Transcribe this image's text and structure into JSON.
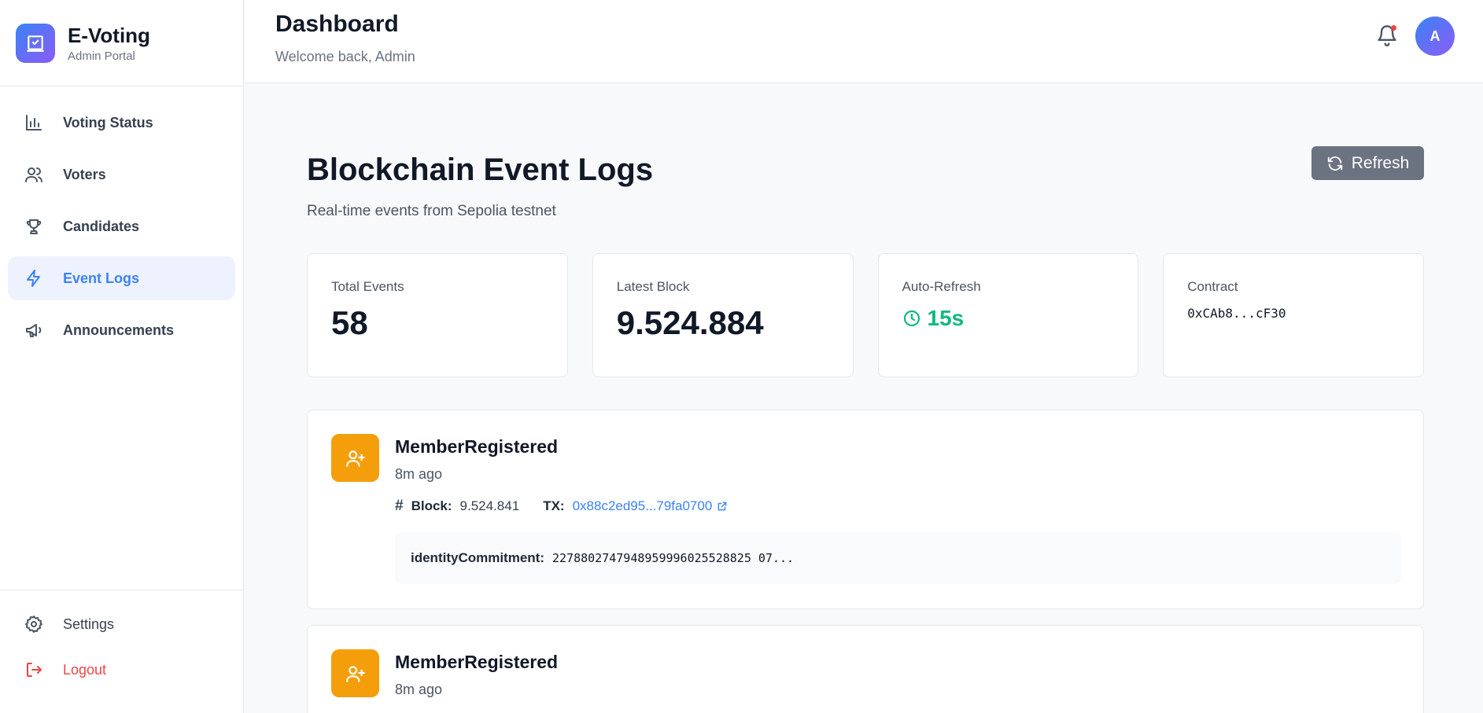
{
  "brand": {
    "name": "E-Voting",
    "subtitle": "Admin Portal"
  },
  "sidebar": {
    "items": [
      {
        "label": "Voting Status",
        "icon": "bar-chart-icon",
        "active": false
      },
      {
        "label": "Voters",
        "icon": "users-icon",
        "active": false
      },
      {
        "label": "Candidates",
        "icon": "trophy-icon",
        "active": false
      },
      {
        "label": "Event Logs",
        "icon": "lightning-icon",
        "active": true
      },
      {
        "label": "Announcements",
        "icon": "megaphone-icon",
        "active": false
      }
    ],
    "bottom": {
      "settings_label": "Settings",
      "logout_label": "Logout"
    }
  },
  "header": {
    "title": "Dashboard",
    "welcome": "Welcome back, Admin",
    "avatar_initial": "A",
    "has_notification": true
  },
  "page": {
    "title": "Blockchain Event Logs",
    "subtitle": "Real-time events from Sepolia testnet",
    "refresh_label": "Refresh"
  },
  "stats": {
    "total_events": {
      "label": "Total Events",
      "value": "58"
    },
    "latest_block": {
      "label": "Latest Block",
      "value": "9.524.884"
    },
    "auto_refresh": {
      "label": "Auto-Refresh",
      "value": "15s"
    },
    "contract": {
      "label": "Contract",
      "value": "0xCAb8...cF30"
    }
  },
  "events": [
    {
      "name": "MemberRegistered",
      "time": "8m ago",
      "block_label": "Block:",
      "block": "9.524.841",
      "tx_label": "TX:",
      "tx": "0x88c2ed95...79fa0700",
      "data_key": "identityCommitment:",
      "data_value": "2278802747948959996025528825 07..."
    },
    {
      "name": "MemberRegistered",
      "time": "8m ago"
    }
  ],
  "colors": {
    "accent": "#3b82f6",
    "event_icon": "#f59e0b",
    "success": "#10b981",
    "danger": "#ef4444",
    "refresh_button": "#6b7280"
  }
}
